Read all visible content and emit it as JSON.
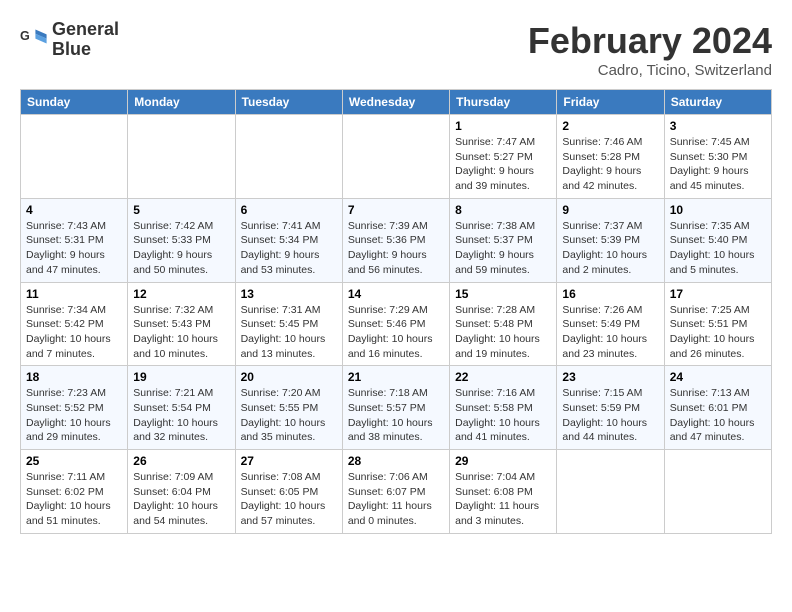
{
  "logo": {
    "line1": "General",
    "line2": "Blue"
  },
  "title": "February 2024",
  "location": "Cadro, Ticino, Switzerland",
  "days_of_week": [
    "Sunday",
    "Monday",
    "Tuesday",
    "Wednesday",
    "Thursday",
    "Friday",
    "Saturday"
  ],
  "weeks": [
    [
      {
        "day": "",
        "info": ""
      },
      {
        "day": "",
        "info": ""
      },
      {
        "day": "",
        "info": ""
      },
      {
        "day": "",
        "info": ""
      },
      {
        "day": "1",
        "info": "Sunrise: 7:47 AM\nSunset: 5:27 PM\nDaylight: 9 hours\nand 39 minutes."
      },
      {
        "day": "2",
        "info": "Sunrise: 7:46 AM\nSunset: 5:28 PM\nDaylight: 9 hours\nand 42 minutes."
      },
      {
        "day": "3",
        "info": "Sunrise: 7:45 AM\nSunset: 5:30 PM\nDaylight: 9 hours\nand 45 minutes."
      }
    ],
    [
      {
        "day": "4",
        "info": "Sunrise: 7:43 AM\nSunset: 5:31 PM\nDaylight: 9 hours\nand 47 minutes."
      },
      {
        "day": "5",
        "info": "Sunrise: 7:42 AM\nSunset: 5:33 PM\nDaylight: 9 hours\nand 50 minutes."
      },
      {
        "day": "6",
        "info": "Sunrise: 7:41 AM\nSunset: 5:34 PM\nDaylight: 9 hours\nand 53 minutes."
      },
      {
        "day": "7",
        "info": "Sunrise: 7:39 AM\nSunset: 5:36 PM\nDaylight: 9 hours\nand 56 minutes."
      },
      {
        "day": "8",
        "info": "Sunrise: 7:38 AM\nSunset: 5:37 PM\nDaylight: 9 hours\nand 59 minutes."
      },
      {
        "day": "9",
        "info": "Sunrise: 7:37 AM\nSunset: 5:39 PM\nDaylight: 10 hours\nand 2 minutes."
      },
      {
        "day": "10",
        "info": "Sunrise: 7:35 AM\nSunset: 5:40 PM\nDaylight: 10 hours\nand 5 minutes."
      }
    ],
    [
      {
        "day": "11",
        "info": "Sunrise: 7:34 AM\nSunset: 5:42 PM\nDaylight: 10 hours\nand 7 minutes."
      },
      {
        "day": "12",
        "info": "Sunrise: 7:32 AM\nSunset: 5:43 PM\nDaylight: 10 hours\nand 10 minutes."
      },
      {
        "day": "13",
        "info": "Sunrise: 7:31 AM\nSunset: 5:45 PM\nDaylight: 10 hours\nand 13 minutes."
      },
      {
        "day": "14",
        "info": "Sunrise: 7:29 AM\nSunset: 5:46 PM\nDaylight: 10 hours\nand 16 minutes."
      },
      {
        "day": "15",
        "info": "Sunrise: 7:28 AM\nSunset: 5:48 PM\nDaylight: 10 hours\nand 19 minutes."
      },
      {
        "day": "16",
        "info": "Sunrise: 7:26 AM\nSunset: 5:49 PM\nDaylight: 10 hours\nand 23 minutes."
      },
      {
        "day": "17",
        "info": "Sunrise: 7:25 AM\nSunset: 5:51 PM\nDaylight: 10 hours\nand 26 minutes."
      }
    ],
    [
      {
        "day": "18",
        "info": "Sunrise: 7:23 AM\nSunset: 5:52 PM\nDaylight: 10 hours\nand 29 minutes."
      },
      {
        "day": "19",
        "info": "Sunrise: 7:21 AM\nSunset: 5:54 PM\nDaylight: 10 hours\nand 32 minutes."
      },
      {
        "day": "20",
        "info": "Sunrise: 7:20 AM\nSunset: 5:55 PM\nDaylight: 10 hours\nand 35 minutes."
      },
      {
        "day": "21",
        "info": "Sunrise: 7:18 AM\nSunset: 5:57 PM\nDaylight: 10 hours\nand 38 minutes."
      },
      {
        "day": "22",
        "info": "Sunrise: 7:16 AM\nSunset: 5:58 PM\nDaylight: 10 hours\nand 41 minutes."
      },
      {
        "day": "23",
        "info": "Sunrise: 7:15 AM\nSunset: 5:59 PM\nDaylight: 10 hours\nand 44 minutes."
      },
      {
        "day": "24",
        "info": "Sunrise: 7:13 AM\nSunset: 6:01 PM\nDaylight: 10 hours\nand 47 minutes."
      }
    ],
    [
      {
        "day": "25",
        "info": "Sunrise: 7:11 AM\nSunset: 6:02 PM\nDaylight: 10 hours\nand 51 minutes."
      },
      {
        "day": "26",
        "info": "Sunrise: 7:09 AM\nSunset: 6:04 PM\nDaylight: 10 hours\nand 54 minutes."
      },
      {
        "day": "27",
        "info": "Sunrise: 7:08 AM\nSunset: 6:05 PM\nDaylight: 10 hours\nand 57 minutes."
      },
      {
        "day": "28",
        "info": "Sunrise: 7:06 AM\nSunset: 6:07 PM\nDaylight: 11 hours\nand 0 minutes."
      },
      {
        "day": "29",
        "info": "Sunrise: 7:04 AM\nSunset: 6:08 PM\nDaylight: 11 hours\nand 3 minutes."
      },
      {
        "day": "",
        "info": ""
      },
      {
        "day": "",
        "info": ""
      }
    ]
  ]
}
